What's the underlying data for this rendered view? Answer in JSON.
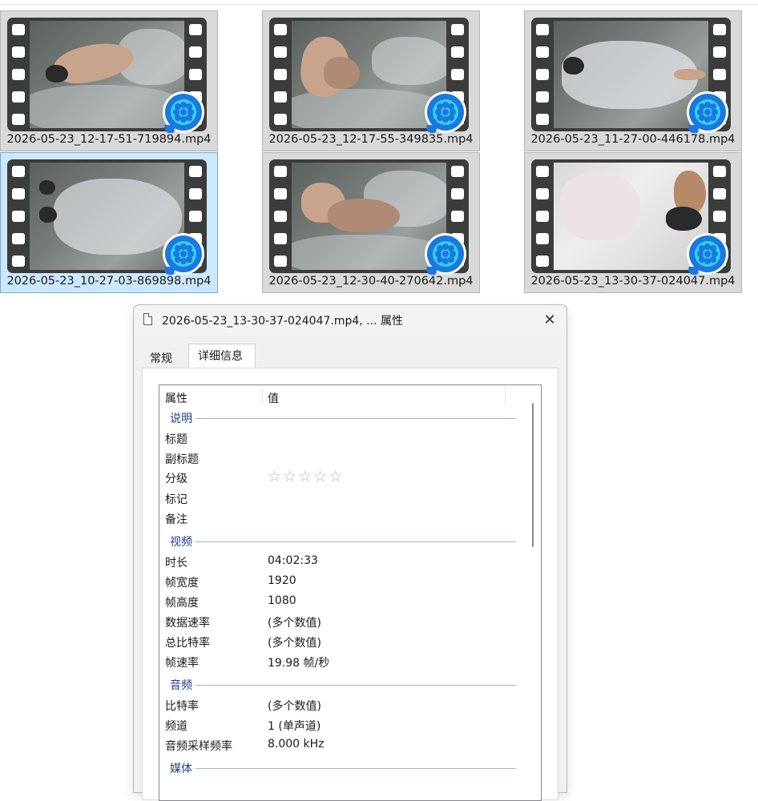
{
  "files": [
    {
      "name": "2026-05-23_12-17-51-719894.mp4",
      "selected": false
    },
    {
      "name": "2026-05-23_12-17-55-349835.mp4",
      "selected": false
    },
    {
      "name": "2026-05-23_11-27-00-446178.mp4",
      "selected": false
    },
    {
      "name": "2026-05-23_10-27-03-869898.mp4",
      "selected": true
    },
    {
      "name": "2026-05-23_12-30-40-270642.mp4",
      "selected": false
    },
    {
      "name": "2026-05-23_13-30-37-024047.mp4",
      "selected": false
    }
  ],
  "icons": {
    "thumbnail": "video-thumbnail-icon",
    "player": "video-player-app-icon",
    "window": "document-icon",
    "close": "close-icon",
    "rating": "star-icon"
  },
  "colors": {
    "selected_tile": "#cce8ff",
    "group_heading": "#1e3f8a",
    "player_icon": "#1a78e0"
  },
  "dialog": {
    "title": "2026-05-23_13-30-37-024047.mp4, ... 属性",
    "close_glyph": "✕",
    "tabs": [
      {
        "label": "常规",
        "active": false
      },
      {
        "label": "详细信息",
        "active": true
      }
    ],
    "columns": {
      "property": "属性",
      "value": "值"
    },
    "sections": [
      {
        "heading": "说明",
        "rows": [
          {
            "key": "标题",
            "value": ""
          },
          {
            "key": "副标题",
            "value": ""
          },
          {
            "key": "分级",
            "value": "",
            "rating_stars": 5,
            "rating_filled": 0
          },
          {
            "key": "标记",
            "value": ""
          },
          {
            "key": "备注",
            "value": ""
          }
        ]
      },
      {
        "heading": "视频",
        "rows": [
          {
            "key": "时长",
            "value": "04:02:33"
          },
          {
            "key": "帧宽度",
            "value": "1920"
          },
          {
            "key": "帧高度",
            "value": "1080"
          },
          {
            "key": "数据速率",
            "value": "(多个数值)"
          },
          {
            "key": "总比特率",
            "value": "(多个数值)"
          },
          {
            "key": "帧速率",
            "value": "19.98 帧/秒"
          }
        ]
      },
      {
        "heading": "音频",
        "rows": [
          {
            "key": "比特率",
            "value": "(多个数值)"
          },
          {
            "key": "频道",
            "value": "1 (单声道)"
          },
          {
            "key": "音频采样频率",
            "value": "8.000 kHz"
          }
        ]
      },
      {
        "heading": "媒体",
        "rows": []
      }
    ],
    "star_glyph": "☆"
  }
}
